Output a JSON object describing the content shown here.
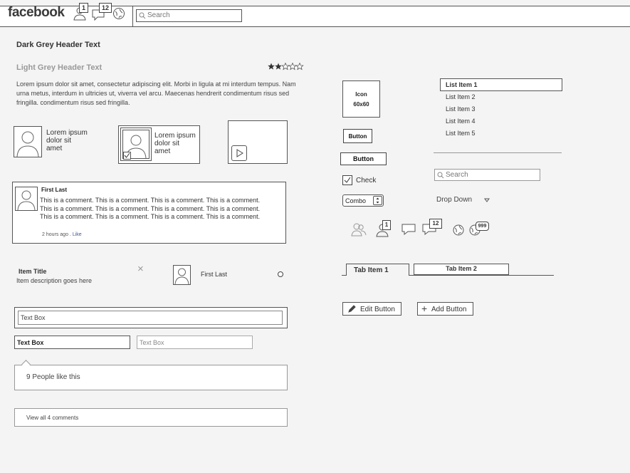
{
  "header": {
    "logo": "facebook",
    "friend_requests_count": "1",
    "messages_count": "12",
    "search_placeholder": "Search"
  },
  "content": {
    "dark_header": "Dark Grey Header Text",
    "light_header": "Light Grey Header Text",
    "rating": {
      "filled": 2,
      "total": 5
    },
    "lorem_paragraph": "Lorem ipsum dolor sit amet, consectetur adipiscing elit. Morbi in ligula at mi interdum tempus. Nam urna metus, interdum in ultricies ut, viverra vel arcu. Maecenas hendrerit condimentum risus sed fringilla. condimentum risus sed fringilla.",
    "profile_card_1": {
      "line1": "Lorem ipsum",
      "line2": "dolor sit",
      "line3": "amet"
    },
    "profile_card_2": {
      "line1": "Lorem ipsum",
      "line2": "dolor sit",
      "line3": "amet"
    },
    "comment": {
      "author": "First Last",
      "text": "This is a comment. This is a comment. This is a comment. This is a comment. This is a comment. This is a comment. This is a comment. This is a comment. This is a comment. This is a comment. This is a comment. This is a comment.",
      "time": "2 hours ago",
      "separator": " . ",
      "like": "Like"
    },
    "item": {
      "title": "Item Title",
      "description": "Item description goes here",
      "close": "×"
    },
    "person": {
      "name": "First Last"
    },
    "text_box_1": "Text Box",
    "text_box_2": "Text Box",
    "text_box_3_placeholder": "Text Box",
    "likes": "9 People like this",
    "view_comments": "View all 4 comments"
  },
  "controls": {
    "icon_placeholder": {
      "line1": "Icon",
      "line2": "60x60"
    },
    "button1": "Button",
    "button2": "Button",
    "checkbox_label": "Check",
    "combo_value": "Combo",
    "dropdown_label": "Drop Down",
    "list": [
      "List Item 1",
      "List Item 2",
      "List Item 3",
      "List Item 4",
      "List Item 5"
    ],
    "search_placeholder": "Search",
    "badge_1": "1",
    "badge_12": "12",
    "badge_999": "999",
    "tabs": [
      "Tab Item 1",
      "Tab Item 2"
    ],
    "edit_button": "Edit Button",
    "add_button": "Add Button"
  }
}
